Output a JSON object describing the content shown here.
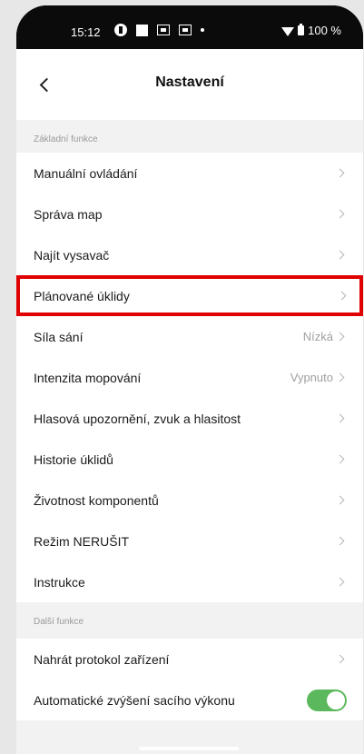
{
  "status": {
    "time": "15:12",
    "battery": "100 %"
  },
  "header": {
    "title": "Nastavení"
  },
  "sections": [
    {
      "label": "Základní funkce",
      "items": [
        {
          "label": "Manuální ovládání"
        },
        {
          "label": "Správa map"
        },
        {
          "label": "Najít vysavač"
        },
        {
          "label": "Plánované úklidy",
          "highlighted": true
        },
        {
          "label": "Síla sání",
          "value": "Nízká"
        },
        {
          "label": "Intenzita mopování",
          "value": "Vypnuto"
        },
        {
          "label": "Hlasová upozornění, zvuk a hlasitost"
        },
        {
          "label": "Historie úklidů"
        },
        {
          "label": "Životnost komponentů"
        },
        {
          "label": "Režim NERUŠIT"
        },
        {
          "label": "Instrukce"
        }
      ]
    },
    {
      "label": "Další funkce",
      "items": [
        {
          "label": "Nahrát protokol zařízení"
        },
        {
          "label": "Automatické zvýšení sacího výkonu",
          "toggle": true
        }
      ]
    }
  ],
  "colors": {
    "highlight": "#e00000",
    "toggle_on": "#5cb85c"
  }
}
